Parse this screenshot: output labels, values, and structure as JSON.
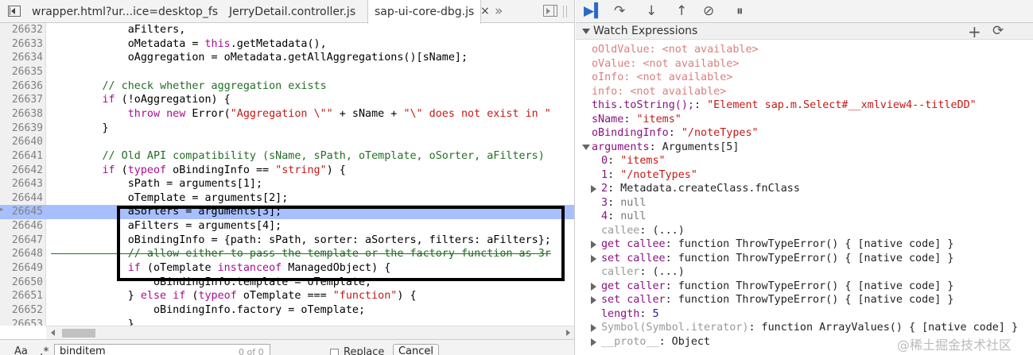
{
  "tabs": [
    {
      "label": "wrapper.html?ur...ice=desktop_fs",
      "close": "",
      "active": false
    },
    {
      "label": "JerryDetail.controller.js",
      "close": "",
      "active": false
    },
    {
      "label": "sap-ui-core-dbg.js",
      "close": "×",
      "active": true
    }
  ],
  "tabs_overflow": "»",
  "code_lines": [
    {
      "n": "26632",
      "segs": [
        [
          "t",
          "            aFilters,"
        ]
      ]
    },
    {
      "n": "26633",
      "segs": [
        [
          "t",
          "            oMetadata = "
        ],
        [
          "kw",
          "this"
        ],
        [
          "t",
          ".getMetadata(),"
        ]
      ]
    },
    {
      "n": "26634",
      "segs": [
        [
          "t",
          "            oAggregation = oMetadata.getAllAggregations()[sName];"
        ]
      ]
    },
    {
      "n": "26635",
      "segs": [
        [
          "t",
          ""
        ]
      ]
    },
    {
      "n": "26636",
      "segs": [
        [
          "cm",
          "        // check whether aggregation exists"
        ]
      ]
    },
    {
      "n": "26637",
      "segs": [
        [
          "t",
          "        "
        ],
        [
          "kw",
          "if"
        ],
        [
          "t",
          " (!oAggregation) {"
        ]
      ]
    },
    {
      "n": "26638",
      "segs": [
        [
          "t",
          "            "
        ],
        [
          "kw",
          "throw new"
        ],
        [
          "t",
          " Error("
        ],
        [
          "str",
          "\"Aggregation \\\"\""
        ],
        [
          "t",
          " + sName + "
        ],
        [
          "str",
          "\"\\\" does not exist in \""
        ]
      ]
    },
    {
      "n": "26639",
      "segs": [
        [
          "t",
          "        }"
        ]
      ]
    },
    {
      "n": "26640",
      "segs": [
        [
          "t",
          ""
        ]
      ]
    },
    {
      "n": "26641",
      "segs": [
        [
          "cm",
          "        // Old API compatibility (sName, sPath, oTemplate, oSorter, aFilters)"
        ]
      ]
    },
    {
      "n": "26642",
      "segs": [
        [
          "t",
          "        "
        ],
        [
          "kw",
          "if"
        ],
        [
          "t",
          " ("
        ],
        [
          "kw",
          "typeof"
        ],
        [
          "t",
          " oBindingInfo == "
        ],
        [
          "str",
          "\"string\""
        ],
        [
          "t",
          ") {"
        ]
      ]
    },
    {
      "n": "26643",
      "segs": [
        [
          "t",
          "            sPath = arguments[1];"
        ]
      ]
    },
    {
      "n": "26644",
      "segs": [
        [
          "t",
          "            oTemplate = arguments[2];"
        ]
      ]
    },
    {
      "n": "26645",
      "segs": [
        [
          "t",
          "            aSorters = arguments[3];"
        ]
      ],
      "hl": true
    },
    {
      "n": "26646",
      "segs": [
        [
          "t",
          "            aFilters = arguments[4];"
        ]
      ]
    },
    {
      "n": "26647",
      "segs": [
        [
          "t",
          "            oBindingInfo = {path: sPath, sorter: aSorters, filters: aFilters};"
        ]
      ]
    },
    {
      "n": "26648",
      "segs": [
        [
          "strike",
          "            // allow either to pass the template or the factory function as 3r"
        ]
      ]
    },
    {
      "n": "26649",
      "segs": [
        [
          "t",
          "            "
        ],
        [
          "kw",
          "if"
        ],
        [
          "t",
          " (oTemplate "
        ],
        [
          "kw",
          "instanceof"
        ],
        [
          "t",
          " ManagedObject) {"
        ]
      ]
    },
    {
      "n": "26650",
      "segs": [
        [
          "t",
          "                oBindingInfo.template = oTemplate;"
        ]
      ]
    },
    {
      "n": "26651",
      "segs": [
        [
          "t",
          "            } "
        ],
        [
          "kw",
          "else if"
        ],
        [
          "t",
          " ("
        ],
        [
          "kw",
          "typeof"
        ],
        [
          "t",
          " oTemplate === "
        ],
        [
          "str",
          "\"function\""
        ],
        [
          "t",
          ") {"
        ]
      ]
    },
    {
      "n": "26652",
      "segs": [
        [
          "t",
          "                oBindingInfo.factory = oTemplate;"
        ]
      ]
    },
    {
      "n": "26653",
      "segs": [
        [
          "t",
          "            }"
        ]
      ]
    }
  ],
  "search": {
    "aa": "Aa",
    "regex": ".*",
    "value": "binditem",
    "count": "0 of 0",
    "replace_label": "Replace",
    "cancel_label": "Cancel"
  },
  "debugger": {
    "section_title": "Watch Expressions",
    "add": "+",
    "refresh": "C"
  },
  "watch": [
    {
      "segs": [
        [
          "na",
          "oOldValue: <not available>"
        ]
      ],
      "indent": 0
    },
    {
      "segs": [
        [
          "na",
          "oValue: <not available>"
        ]
      ],
      "indent": 0
    },
    {
      "segs": [
        [
          "na",
          "oInfo: <not available>"
        ]
      ],
      "indent": 0
    },
    {
      "segs": [
        [
          "na",
          "info: <not available>"
        ]
      ],
      "indent": 0
    },
    {
      "segs": [
        [
          "key",
          "this.toString();"
        ],
        [
          "obj",
          ": "
        ],
        [
          "str",
          "\"Element sap.m.Select#__xmlview4--titleDD\""
        ]
      ],
      "indent": 0
    },
    {
      "segs": [
        [
          "key",
          "sName"
        ],
        [
          "obj",
          ": "
        ],
        [
          "str",
          "\"items\""
        ]
      ],
      "indent": 0
    },
    {
      "segs": [
        [
          "key",
          "oBindingInfo"
        ],
        [
          "obj",
          ": "
        ],
        [
          "str",
          "\"/noteTypes\""
        ]
      ],
      "indent": 0
    },
    {
      "segs": [
        [
          "key",
          "arguments"
        ],
        [
          "obj",
          ": Arguments[5]"
        ]
      ],
      "indent": 0,
      "tri": "down"
    },
    {
      "segs": [
        [
          "key",
          "0"
        ],
        [
          "obj",
          ": "
        ],
        [
          "str",
          "\"items\""
        ]
      ],
      "indent": 1
    },
    {
      "segs": [
        [
          "key",
          "1"
        ],
        [
          "obj",
          ": "
        ],
        [
          "str",
          "\"/noteTypes\""
        ]
      ],
      "indent": 1
    },
    {
      "segs": [
        [
          "key",
          "2"
        ],
        [
          "obj",
          ": Metadata.createClass.fnClass"
        ]
      ],
      "indent": 1,
      "tri": "right"
    },
    {
      "segs": [
        [
          "key",
          "3"
        ],
        [
          "obj",
          ": "
        ],
        [
          "dim",
          "null"
        ]
      ],
      "indent": 1
    },
    {
      "segs": [
        [
          "key",
          "4"
        ],
        [
          "obj",
          ": "
        ],
        [
          "dim",
          "null"
        ]
      ],
      "indent": 1
    },
    {
      "segs": [
        [
          "gkey",
          "callee"
        ],
        [
          "obj",
          ": (...)"
        ]
      ],
      "indent": 1
    },
    {
      "segs": [
        [
          "key",
          "get callee"
        ],
        [
          "obj",
          ": function ThrowTypeError() { [native code] }"
        ]
      ],
      "indent": 1,
      "tri": "right"
    },
    {
      "segs": [
        [
          "key",
          "set callee"
        ],
        [
          "obj",
          ": function ThrowTypeError() { [native code] }"
        ]
      ],
      "indent": 1,
      "tri": "right"
    },
    {
      "segs": [
        [
          "gkey",
          "caller"
        ],
        [
          "obj",
          ": (...)"
        ]
      ],
      "indent": 1
    },
    {
      "segs": [
        [
          "key",
          "get caller"
        ],
        [
          "obj",
          ": function ThrowTypeError() { [native code] }"
        ]
      ],
      "indent": 1,
      "tri": "right"
    },
    {
      "segs": [
        [
          "key",
          "set caller"
        ],
        [
          "obj",
          ": function ThrowTypeError() { [native code] }"
        ]
      ],
      "indent": 1,
      "tri": "right"
    },
    {
      "segs": [
        [
          "key",
          "length"
        ],
        [
          "obj",
          ": "
        ],
        [
          "num",
          "5"
        ]
      ],
      "indent": 1
    },
    {
      "segs": [
        [
          "gkey",
          "Symbol(Symbol.iterator)"
        ],
        [
          "obj",
          ": function ArrayValues() { [native code] }"
        ]
      ],
      "indent": 1,
      "tri": "right"
    },
    {
      "segs": [
        [
          "gkey",
          "__proto__"
        ],
        [
          "obj",
          ": Object"
        ]
      ],
      "indent": 1,
      "tri": "right"
    }
  ],
  "watermark": "@稀土掘金技术社区"
}
